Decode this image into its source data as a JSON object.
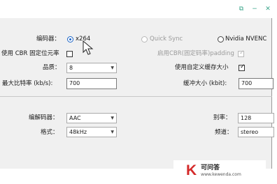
{
  "titlebar": {
    "buttons": [
      "restore-icon",
      "minimize-icon",
      "close-icon"
    ]
  },
  "video": {
    "encoder_label": "编码器：",
    "encoder_options": [
      {
        "label": "x264",
        "selected": true,
        "enabled": true
      },
      {
        "label": "Quick Sync",
        "selected": false,
        "enabled": false
      },
      {
        "label": "Nvidia NVENC",
        "selected": false,
        "enabled": true
      }
    ],
    "cbr_label": "使用 CBR 固定位元率",
    "cbr_checked": false,
    "cbr_padding_label": "启用CBR(固定码率)padding",
    "cbr_padding_checked": true,
    "quality_label": "品质：",
    "quality_value": "8",
    "custom_buffer_label": "使用自定义缓存大小",
    "custom_buffer_checked": true,
    "max_bitrate_label": "最大比特率 (kb/s):",
    "max_bitrate_value": "700",
    "buffer_size_label": "缓冲大小 (kbit):",
    "buffer_size_value": "700"
  },
  "audio": {
    "codec_label": "编解码器：",
    "codec_value": "AAC",
    "bitrate_label": "别率：",
    "bitrate_value": "128",
    "format_label": "格式：",
    "format_value": "48kHz",
    "channels_label": "频道：",
    "channels_value": "stereo"
  },
  "watermark": {
    "logo": "K",
    "title": "可问答",
    "url": "www.kewenda.com"
  },
  "colors": {
    "accent": "#1a64c8",
    "panel": "#f0f0f0",
    "watermark_red": "#d42a2a",
    "titlebar_icons": "#3aa58a"
  }
}
